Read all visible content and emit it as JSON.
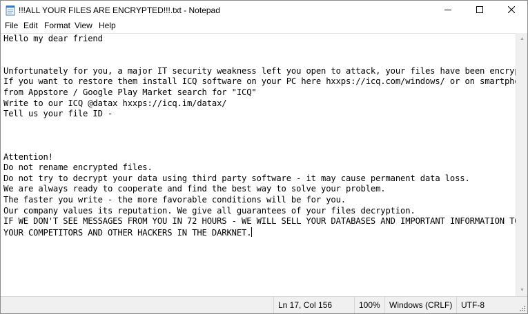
{
  "window": {
    "title": "!!!ALL YOUR FILES ARE ENCRYPTED!!!.txt - Notepad",
    "app_icon": "notepad-icon",
    "controls": {
      "minimize_icon": "minimize-icon",
      "maximize_icon": "maximize-icon",
      "close_icon": "close-icon"
    }
  },
  "menu": {
    "file": "File",
    "edit": "Edit",
    "format": "Format",
    "view": "View",
    "help": "Help"
  },
  "editor": {
    "lines": [
      "Hello my dear friend",
      "",
      "",
      "Unfortunately for you, a major IT security weakness left you open to attack, your files have been encrypted",
      "If you want to restore them install ICQ software on your PC here hxxps://icq.com/windows/ or on smartphone",
      "from Appstore / Google Play Market search for \"ICQ\"",
      "Write to our ICQ @datax hxxps://icq.im/datax/",
      "Tell us your file ID -",
      "",
      "",
      "",
      "Attention!",
      "Do not rename encrypted files.",
      "Do not try to decrypt your data using third party software - it may cause permanent data loss.",
      "We are always ready to cooperate and find the best way to solve your problem.",
      "The faster you write - the more favorable conditions will be for you.",
      "Our company values its reputation. We give all guarantees of your files decryption.",
      "IF WE DON'T SEE MESSAGES FROM YOU IN 72 HOURS - WE WILL SELL YOUR DATABASES AND IMPORTANT INFORMATION TO",
      "YOUR COMPETITORS AND OTHER HACKERS IN THE DARKNET."
    ]
  },
  "status": {
    "position": "Ln 17, Col 156",
    "zoom": "100%",
    "line_ending": "Windows (CRLF)",
    "encoding": "UTF-8"
  },
  "colors": {
    "background": "#ffffff",
    "statusbar": "#f0f0f0",
    "text": "#000000"
  }
}
